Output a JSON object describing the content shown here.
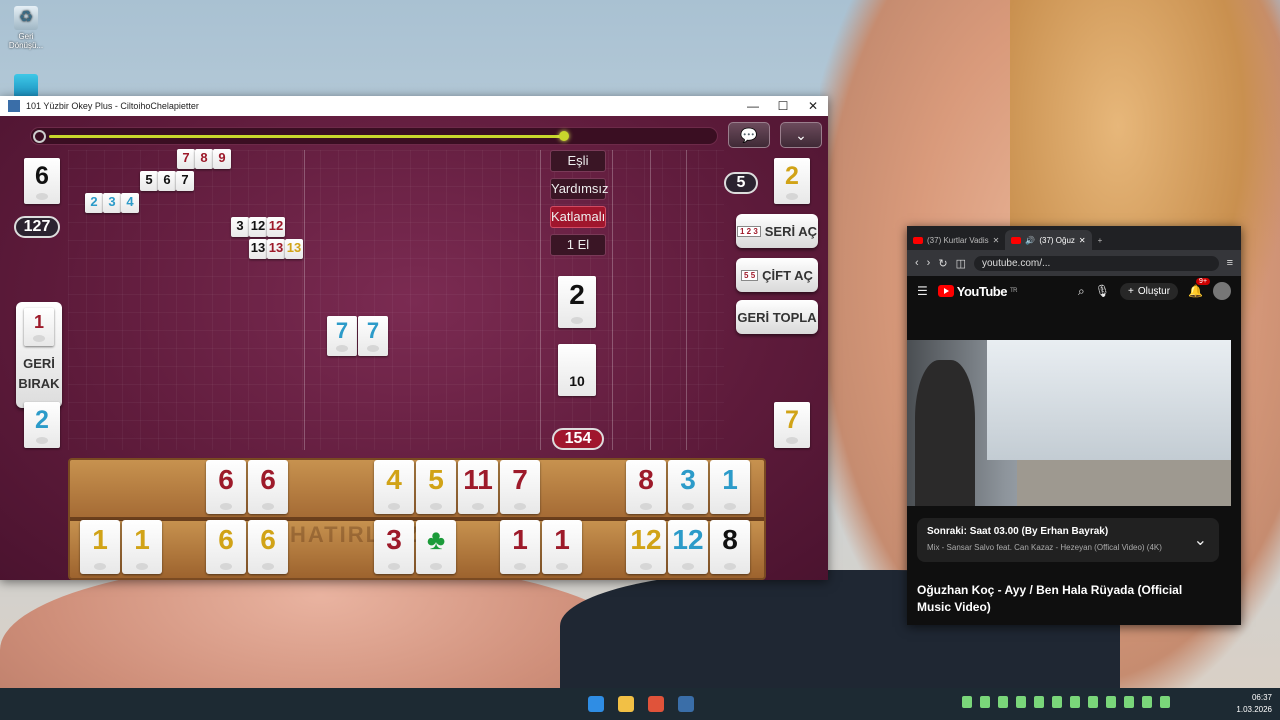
{
  "desktop": {
    "recycle_bin_label": "Geri Dönüşü...",
    "colors": {
      "wallpaper": "#a9c1d2"
    }
  },
  "game_window": {
    "title": "101 Yüzbir Okey Plus - CiltoihoChelapietter",
    "minimize": "—",
    "maximize": "☐",
    "close": "✕",
    "chat_icon": "chat-bubble-icon",
    "collapse_icon": "chevron-down-icon",
    "timer_progress": 0.78,
    "left_counter_top": "6",
    "left_score": "127",
    "discard_tile": "1",
    "back_button": [
      "GERİ",
      "BIRAK"
    ],
    "left_bottom_tile": "2",
    "right_counter_top": "2",
    "right_pill": "5",
    "right_bottom_tile": "7",
    "options": {
      "esli": "Eşli",
      "yardimsiz": "Yardımsız",
      "katlamali": "Katlamalı",
      "bir_el": "1 El"
    },
    "indicator_tile": "2",
    "deck_count": "10",
    "center_score": "154",
    "buttons": {
      "seri_ac": "SERİ AÇ",
      "cift_ac": "ÇİFT AÇ",
      "geri_topla": "GERİ TOPLA",
      "mini1": "1 2 3",
      "mini2": "5 5"
    },
    "table_sets": [
      {
        "tiles": [
          "7",
          "8",
          "9"
        ],
        "color": "red"
      },
      {
        "tiles": [
          "5",
          "6",
          "7"
        ],
        "color": "blk"
      },
      {
        "tiles": [
          "2",
          "3",
          "4"
        ],
        "color": "blu"
      },
      {
        "tiles": [
          "3",
          "12",
          "12"
        ],
        "colors": [
          "blk",
          "blk",
          "red"
        ]
      },
      {
        "tiles": [
          "13",
          "13",
          "13"
        ],
        "colors": [
          "blk",
          "red",
          "yel"
        ]
      }
    ],
    "center_pair": [
      "7",
      "7"
    ],
    "rack_top": [
      {
        "v": "6",
        "c": "red"
      },
      {
        "v": "6",
        "c": "red"
      },
      {
        "v": "4",
        "c": "yel"
      },
      {
        "v": "5",
        "c": "yel"
      },
      {
        "v": "11",
        "c": "red"
      },
      {
        "v": "7",
        "c": "red"
      },
      {
        "v": "8",
        "c": "red"
      },
      {
        "v": "3",
        "c": "blu"
      },
      {
        "v": "1",
        "c": "blu"
      }
    ],
    "rack_bottom": [
      {
        "v": "1",
        "c": "yel"
      },
      {
        "v": "1",
        "c": "yel"
      },
      {
        "v": "6",
        "c": "yel"
      },
      {
        "v": "6",
        "c": "yel"
      },
      {
        "v": "3",
        "c": "red"
      },
      {
        "v": "♣",
        "c": "grn"
      },
      {
        "v": "1",
        "c": "red"
      },
      {
        "v": "1",
        "c": "red"
      },
      {
        "v": "12",
        "c": "yel"
      },
      {
        "v": "12",
        "c": "blu"
      },
      {
        "v": "8",
        "c": "blk"
      }
    ],
    "rack_watermark": "HATIRLE    Z I"
  },
  "browser": {
    "tab1": "(37) Kurtlar Vadis",
    "tab2": "(37) Oğuz",
    "url": "youtube.com/...",
    "yt_logo": "YouTube",
    "yt_region": "TR",
    "create": "Oluştur",
    "notif_badge": "9+",
    "up_next_title": "Sonraki: Saat 03.00 (By Erhan Bayrak)",
    "up_next_sub": "Mix - Sansar Salvo feat. Can Kazaz - Hezeyan (Offical Video) (4K)",
    "video_title": "Oğuzhan Koç - Ayy / Ben Hala Rüyada (Official Music Video)"
  },
  "taskbar": {
    "time": "06:37",
    "date": "1.03.2026"
  }
}
